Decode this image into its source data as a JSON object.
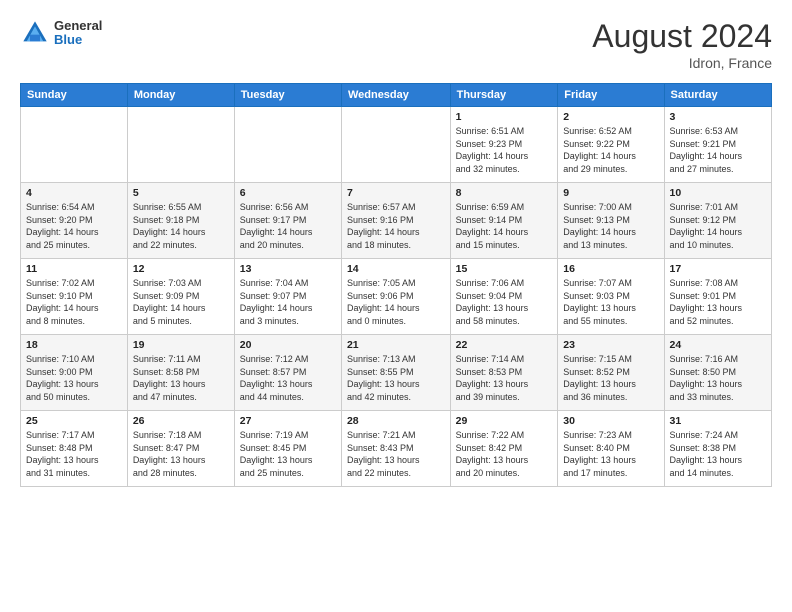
{
  "header": {
    "logo_general": "General",
    "logo_blue": "Blue",
    "month_title": "August 2024",
    "location": "Idron, France"
  },
  "weekdays": [
    "Sunday",
    "Monday",
    "Tuesday",
    "Wednesday",
    "Thursday",
    "Friday",
    "Saturday"
  ],
  "weeks": [
    [
      {
        "day": "",
        "info": ""
      },
      {
        "day": "",
        "info": ""
      },
      {
        "day": "",
        "info": ""
      },
      {
        "day": "",
        "info": ""
      },
      {
        "day": "1",
        "info": "Sunrise: 6:51 AM\nSunset: 9:23 PM\nDaylight: 14 hours\nand 32 minutes."
      },
      {
        "day": "2",
        "info": "Sunrise: 6:52 AM\nSunset: 9:22 PM\nDaylight: 14 hours\nand 29 minutes."
      },
      {
        "day": "3",
        "info": "Sunrise: 6:53 AM\nSunset: 9:21 PM\nDaylight: 14 hours\nand 27 minutes."
      }
    ],
    [
      {
        "day": "4",
        "info": "Sunrise: 6:54 AM\nSunset: 9:20 PM\nDaylight: 14 hours\nand 25 minutes."
      },
      {
        "day": "5",
        "info": "Sunrise: 6:55 AM\nSunset: 9:18 PM\nDaylight: 14 hours\nand 22 minutes."
      },
      {
        "day": "6",
        "info": "Sunrise: 6:56 AM\nSunset: 9:17 PM\nDaylight: 14 hours\nand 20 minutes."
      },
      {
        "day": "7",
        "info": "Sunrise: 6:57 AM\nSunset: 9:16 PM\nDaylight: 14 hours\nand 18 minutes."
      },
      {
        "day": "8",
        "info": "Sunrise: 6:59 AM\nSunset: 9:14 PM\nDaylight: 14 hours\nand 15 minutes."
      },
      {
        "day": "9",
        "info": "Sunrise: 7:00 AM\nSunset: 9:13 PM\nDaylight: 14 hours\nand 13 minutes."
      },
      {
        "day": "10",
        "info": "Sunrise: 7:01 AM\nSunset: 9:12 PM\nDaylight: 14 hours\nand 10 minutes."
      }
    ],
    [
      {
        "day": "11",
        "info": "Sunrise: 7:02 AM\nSunset: 9:10 PM\nDaylight: 14 hours\nand 8 minutes."
      },
      {
        "day": "12",
        "info": "Sunrise: 7:03 AM\nSunset: 9:09 PM\nDaylight: 14 hours\nand 5 minutes."
      },
      {
        "day": "13",
        "info": "Sunrise: 7:04 AM\nSunset: 9:07 PM\nDaylight: 14 hours\nand 3 minutes."
      },
      {
        "day": "14",
        "info": "Sunrise: 7:05 AM\nSunset: 9:06 PM\nDaylight: 14 hours\nand 0 minutes."
      },
      {
        "day": "15",
        "info": "Sunrise: 7:06 AM\nSunset: 9:04 PM\nDaylight: 13 hours\nand 58 minutes."
      },
      {
        "day": "16",
        "info": "Sunrise: 7:07 AM\nSunset: 9:03 PM\nDaylight: 13 hours\nand 55 minutes."
      },
      {
        "day": "17",
        "info": "Sunrise: 7:08 AM\nSunset: 9:01 PM\nDaylight: 13 hours\nand 52 minutes."
      }
    ],
    [
      {
        "day": "18",
        "info": "Sunrise: 7:10 AM\nSunset: 9:00 PM\nDaylight: 13 hours\nand 50 minutes."
      },
      {
        "day": "19",
        "info": "Sunrise: 7:11 AM\nSunset: 8:58 PM\nDaylight: 13 hours\nand 47 minutes."
      },
      {
        "day": "20",
        "info": "Sunrise: 7:12 AM\nSunset: 8:57 PM\nDaylight: 13 hours\nand 44 minutes."
      },
      {
        "day": "21",
        "info": "Sunrise: 7:13 AM\nSunset: 8:55 PM\nDaylight: 13 hours\nand 42 minutes."
      },
      {
        "day": "22",
        "info": "Sunrise: 7:14 AM\nSunset: 8:53 PM\nDaylight: 13 hours\nand 39 minutes."
      },
      {
        "day": "23",
        "info": "Sunrise: 7:15 AM\nSunset: 8:52 PM\nDaylight: 13 hours\nand 36 minutes."
      },
      {
        "day": "24",
        "info": "Sunrise: 7:16 AM\nSunset: 8:50 PM\nDaylight: 13 hours\nand 33 minutes."
      }
    ],
    [
      {
        "day": "25",
        "info": "Sunrise: 7:17 AM\nSunset: 8:48 PM\nDaylight: 13 hours\nand 31 minutes."
      },
      {
        "day": "26",
        "info": "Sunrise: 7:18 AM\nSunset: 8:47 PM\nDaylight: 13 hours\nand 28 minutes."
      },
      {
        "day": "27",
        "info": "Sunrise: 7:19 AM\nSunset: 8:45 PM\nDaylight: 13 hours\nand 25 minutes."
      },
      {
        "day": "28",
        "info": "Sunrise: 7:21 AM\nSunset: 8:43 PM\nDaylight: 13 hours\nand 22 minutes."
      },
      {
        "day": "29",
        "info": "Sunrise: 7:22 AM\nSunset: 8:42 PM\nDaylight: 13 hours\nand 20 minutes."
      },
      {
        "day": "30",
        "info": "Sunrise: 7:23 AM\nSunset: 8:40 PM\nDaylight: 13 hours\nand 17 minutes."
      },
      {
        "day": "31",
        "info": "Sunrise: 7:24 AM\nSunset: 8:38 PM\nDaylight: 13 hours\nand 14 minutes."
      }
    ]
  ]
}
